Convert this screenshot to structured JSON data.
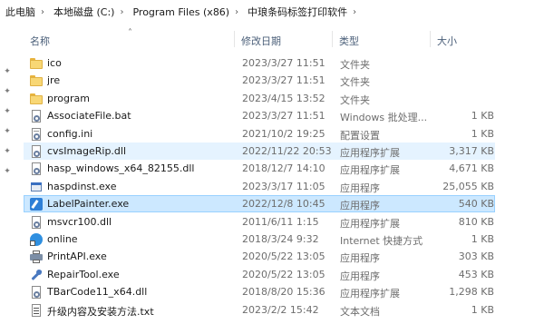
{
  "breadcrumb": [
    "此电脑",
    "本地磁盘 (C:)",
    "Program Files (x86)",
    "中琅条码标签打印软件"
  ],
  "columns": {
    "name": "名称",
    "date": "修改日期",
    "type": "类型",
    "size": "大小"
  },
  "files": [
    {
      "name": "ico",
      "date": "2023/3/27 11:51",
      "type": "文件夹",
      "size": "",
      "icon": "folder-icon"
    },
    {
      "name": "jre",
      "date": "2023/3/27 11:51",
      "type": "文件夹",
      "size": "",
      "icon": "folder-icon"
    },
    {
      "name": "program",
      "date": "2023/4/15 13:52",
      "type": "文件夹",
      "size": "",
      "icon": "folder-icon"
    },
    {
      "name": "AssociateFile.bat",
      "date": "2023/3/27 11:51",
      "type": "Windows 批处理...",
      "size": "1 KB",
      "icon": "batch-file-icon"
    },
    {
      "name": "config.ini",
      "date": "2021/10/2 19:25",
      "type": "配置设置",
      "size": "1 KB",
      "icon": "settings-file-icon"
    },
    {
      "name": "cvsImageRip.dll",
      "date": "2022/11/22 20:53",
      "type": "应用程序扩展",
      "size": "3,317 KB",
      "icon": "dll-file-icon"
    },
    {
      "name": "hasp_windows_x64_82155.dll",
      "date": "2018/12/7 14:10",
      "type": "应用程序扩展",
      "size": "4,671 KB",
      "icon": "dll-file-icon"
    },
    {
      "name": "haspdinst.exe",
      "date": "2023/3/17 11:05",
      "type": "应用程序",
      "size": "25,055 KB",
      "icon": "exe-icon"
    },
    {
      "name": "LabelPainter.exe",
      "date": "2022/12/8 10:45",
      "type": "应用程序",
      "size": "540 KB",
      "icon": "labelpainter-app-icon"
    },
    {
      "name": "msvcr100.dll",
      "date": "2011/6/11 1:15",
      "type": "应用程序扩展",
      "size": "810 KB",
      "icon": "dll-file-icon"
    },
    {
      "name": "online",
      "date": "2018/3/24 9:32",
      "type": "Internet 快捷方式",
      "size": "1 KB",
      "icon": "internet-shortcut-icon"
    },
    {
      "name": "PrintAPI.exe",
      "date": "2020/5/22 13:05",
      "type": "应用程序",
      "size": "303 KB",
      "icon": "printer-icon"
    },
    {
      "name": "RepairTool.exe",
      "date": "2020/5/22 13:05",
      "type": "应用程序",
      "size": "453 KB",
      "icon": "wrench-icon"
    },
    {
      "name": "TBarCode11_x64.dll",
      "date": "2018/8/20 15:36",
      "type": "应用程序扩展",
      "size": "1,298 KB",
      "icon": "dll-file-icon"
    },
    {
      "name": "升级内容及安装方法.txt",
      "date": "2023/2/2 15:42",
      "type": "文本文档",
      "size": "1 KB",
      "icon": "text-file-icon"
    }
  ],
  "hover_row": "cvsImageRip.dll",
  "selected_row": "LabelPainter.exe",
  "colors": {
    "hover": "#e5f3ff",
    "selected": "#cce8ff",
    "selected_border": "#99d1ff",
    "header_text": "#4c607a"
  }
}
